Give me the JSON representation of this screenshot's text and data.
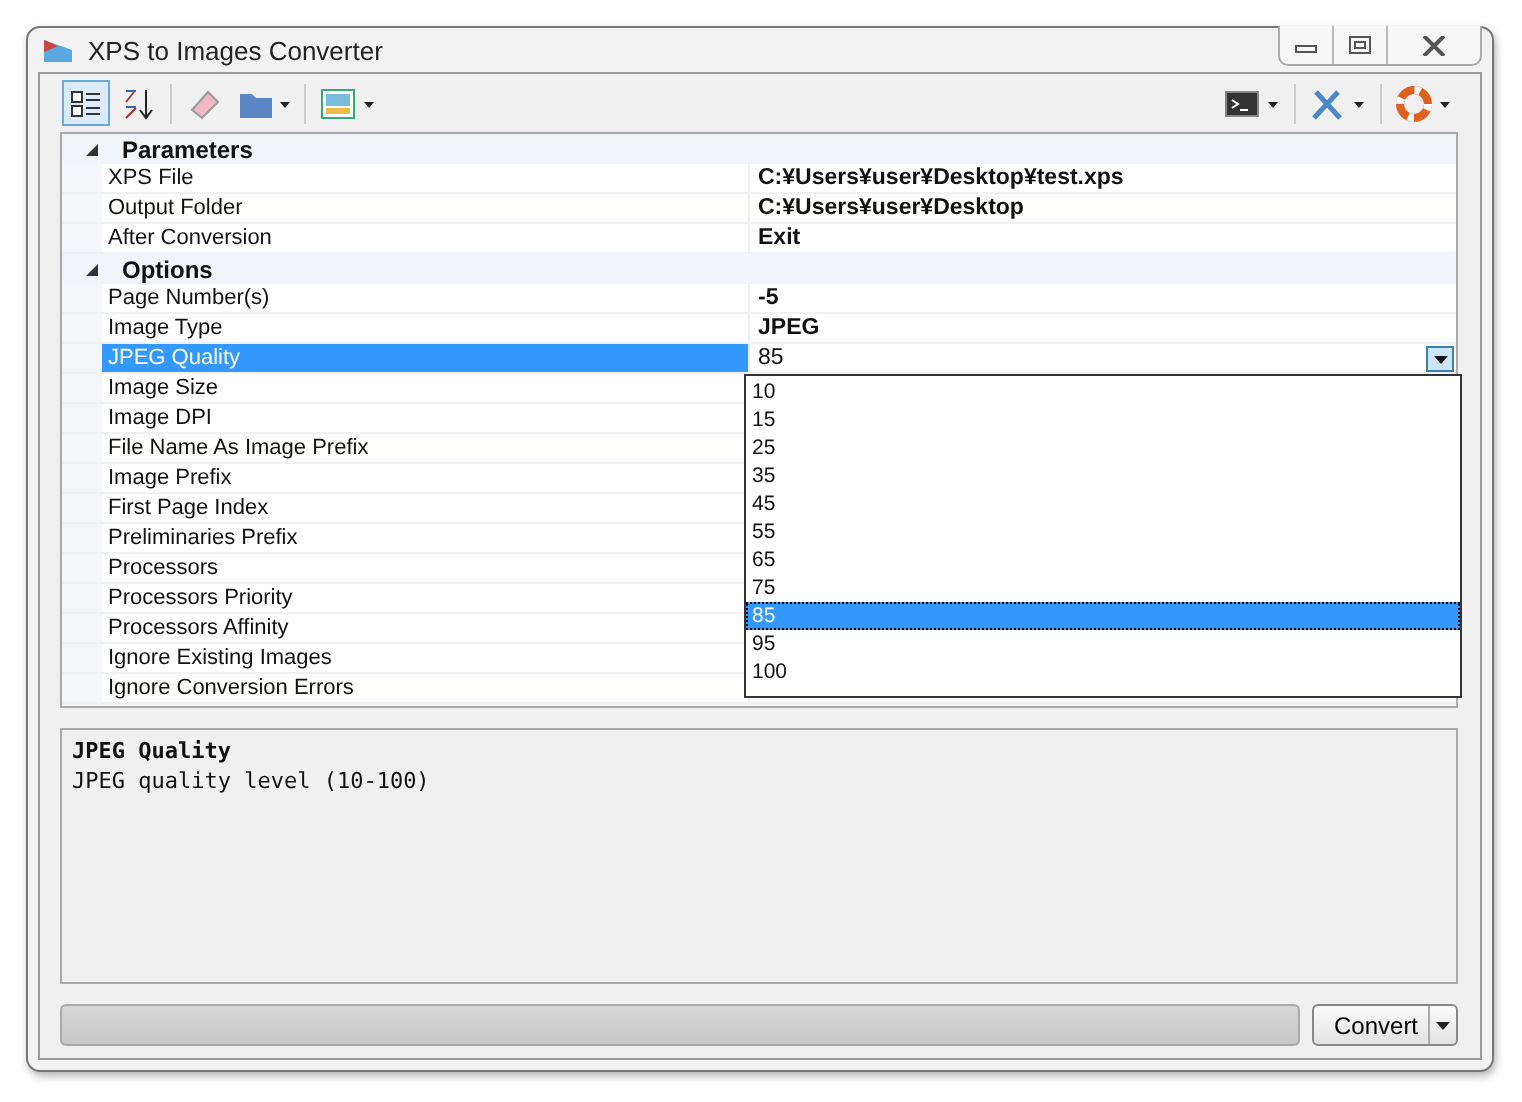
{
  "window": {
    "title": "XPS to Images Converter"
  },
  "grid": {
    "categories": [
      {
        "name": "Parameters",
        "expanded": true,
        "properties": [
          {
            "name": "XPS File",
            "value": "C:¥Users¥user¥Desktop¥test.xps",
            "selected": false
          },
          {
            "name": "Output Folder",
            "value": "C:¥Users¥user¥Desktop",
            "selected": false
          },
          {
            "name": "After Conversion",
            "value": "Exit",
            "selected": false
          }
        ]
      },
      {
        "name": "Options",
        "expanded": true,
        "properties": [
          {
            "name": "Page Number(s)",
            "value": "-5",
            "selected": false
          },
          {
            "name": "Image Type",
            "value": "JPEG",
            "selected": false
          },
          {
            "name": "JPEG Quality",
            "value": "85",
            "selected": true,
            "kind": "dropdown"
          },
          {
            "name": "Image Size",
            "selected": false
          },
          {
            "name": "Image DPI",
            "selected": false
          },
          {
            "name": "File Name As Image Prefix",
            "selected": false
          },
          {
            "name": "Image Prefix",
            "selected": false
          },
          {
            "name": "First Page Index",
            "selected": false
          },
          {
            "name": "Preliminaries Prefix",
            "selected": false
          },
          {
            "name": "Processors",
            "selected": false
          },
          {
            "name": "Processors Priority",
            "selected": false
          },
          {
            "name": "Processors Affinity",
            "selected": false
          },
          {
            "name": "Ignore Existing Images",
            "selected": false
          },
          {
            "name": "Ignore Conversion Errors",
            "selected": false
          }
        ]
      }
    ]
  },
  "dropdown": {
    "items": [
      {
        "label": "10",
        "selected": false
      },
      {
        "label": "15",
        "selected": false
      },
      {
        "label": "25",
        "selected": false
      },
      {
        "label": "35",
        "selected": false
      },
      {
        "label": "45",
        "selected": false
      },
      {
        "label": "55",
        "selected": false
      },
      {
        "label": "65",
        "selected": false
      },
      {
        "label": "75",
        "selected": false
      },
      {
        "label": "85",
        "selected": true
      },
      {
        "label": "95",
        "selected": false
      },
      {
        "label": "100",
        "selected": false
      }
    ]
  },
  "description": {
    "title": "JPEG Quality",
    "text": "JPEG quality level (10-100)"
  },
  "progress": {
    "level": 0
  },
  "convert_button": {
    "label": "Convert"
  }
}
